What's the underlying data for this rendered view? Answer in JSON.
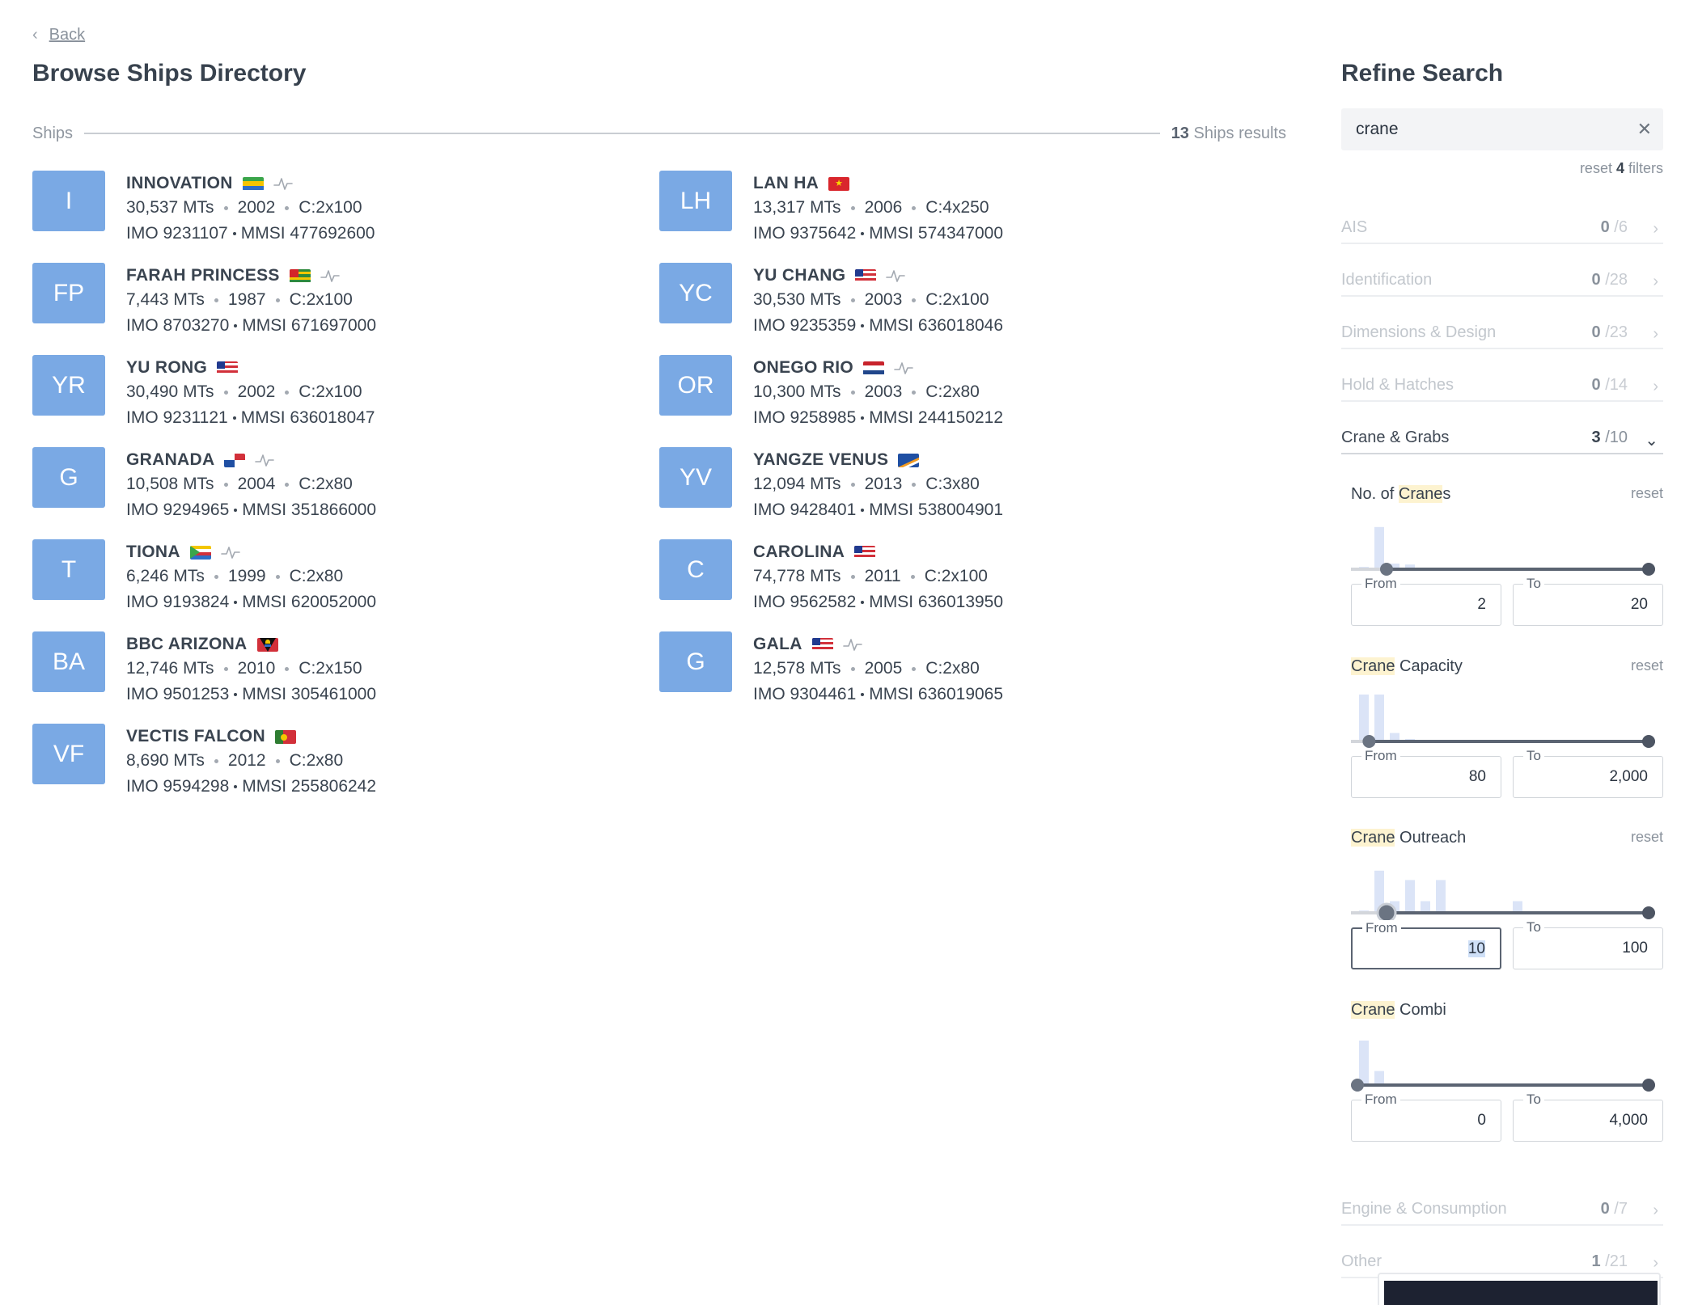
{
  "nav": {
    "back_label": "Back"
  },
  "page": {
    "title": "Browse Ships Directory"
  },
  "results": {
    "section_label": "Ships",
    "count": "13",
    "count_suffix": " Ships results"
  },
  "ships": [
    {
      "initials": "I",
      "name": "INNOVATION",
      "flag": "gabon",
      "ais": true,
      "dwt": "30,537 MTs",
      "year": "2002",
      "cranes": "C:2x100",
      "imo": "IMO 9231107",
      "mmsi": "MMSI 477692600"
    },
    {
      "initials": "FP",
      "name": "FARAH PRINCESS",
      "flag": "togo",
      "ais": true,
      "dwt": "7,443 MTs",
      "year": "1987",
      "cranes": "C:2x100",
      "imo": "IMO 8703270",
      "mmsi": "MMSI 671697000"
    },
    {
      "initials": "YR",
      "name": "YU RONG",
      "flag": "liberia",
      "ais": false,
      "dwt": "30,490 MTs",
      "year": "2002",
      "cranes": "C:2x100",
      "imo": "IMO 9231121",
      "mmsi": "MMSI 636018047"
    },
    {
      "initials": "G",
      "name": "GRANADA",
      "flag": "panama",
      "ais": true,
      "dwt": "10,508 MTs",
      "year": "2004",
      "cranes": "C:2x80",
      "imo": "IMO 9294965",
      "mmsi": "MMSI 351866000"
    },
    {
      "initials": "T",
      "name": "TIONA",
      "flag": "comoros",
      "ais": true,
      "dwt": "6,246 MTs",
      "year": "1999",
      "cranes": "C:2x80",
      "imo": "IMO 9193824",
      "mmsi": "MMSI 620052000"
    },
    {
      "initials": "BA",
      "name": "BBC ARIZONA",
      "flag": "antigua",
      "ais": false,
      "dwt": "12,746 MTs",
      "year": "2010",
      "cranes": "C:2x150",
      "imo": "IMO 9501253",
      "mmsi": "MMSI 305461000"
    },
    {
      "initials": "VF",
      "name": "VECTIS FALCON",
      "flag": "portugal",
      "ais": false,
      "dwt": "8,690 MTs",
      "year": "2012",
      "cranes": "C:2x80",
      "imo": "IMO 9594298",
      "mmsi": "MMSI 255806242"
    },
    {
      "initials": "LH",
      "name": "LAN HA",
      "flag": "vietnam",
      "ais": false,
      "dwt": "13,317 MTs",
      "year": "2006",
      "cranes": "C:4x250",
      "imo": "IMO 9375642",
      "mmsi": "MMSI 574347000"
    },
    {
      "initials": "YC",
      "name": "YU CHANG",
      "flag": "liberia",
      "ais": true,
      "dwt": "30,530 MTs",
      "year": "2003",
      "cranes": "C:2x100",
      "imo": "IMO 9235359",
      "mmsi": "MMSI 636018046"
    },
    {
      "initials": "OR",
      "name": "ONEGO RIO",
      "flag": "netherlands",
      "ais": true,
      "dwt": "10,300 MTs",
      "year": "2003",
      "cranes": "C:2x80",
      "imo": "IMO 9258985",
      "mmsi": "MMSI 244150212"
    },
    {
      "initials": "YV",
      "name": "YANGZE VENUS",
      "flag": "marshall",
      "ais": false,
      "dwt": "12,094 MTs",
      "year": "2013",
      "cranes": "C:3x80",
      "imo": "IMO 9428401",
      "mmsi": "MMSI 538004901"
    },
    {
      "initials": "C",
      "name": "CAROLINA",
      "flag": "liberia",
      "ais": false,
      "dwt": "74,778 MTs",
      "year": "2011",
      "cranes": "C:2x100",
      "imo": "IMO 9562582",
      "mmsi": "MMSI 636013950"
    },
    {
      "initials": "G",
      "name": "GALA",
      "flag": "liberia",
      "ais": true,
      "dwt": "12,578 MTs",
      "year": "2005",
      "cranes": "C:2x80",
      "imo": "IMO 9304461",
      "mmsi": "MMSI 636019065"
    }
  ],
  "refine": {
    "title": "Refine Search",
    "search_value": "crane",
    "reset_prefix": "reset ",
    "reset_count": "4",
    "reset_suffix": " filters",
    "facets": [
      {
        "label": "AIS",
        "selected": "0",
        "total": " /6",
        "open": false
      },
      {
        "label": "Identification",
        "selected": "0",
        "total": " /28",
        "open": false
      },
      {
        "label": "Dimensions & Design",
        "selected": "0",
        "total": " /23",
        "open": false
      },
      {
        "label": "Hold & Hatches",
        "selected": "0",
        "total": " /14",
        "open": false
      },
      {
        "label": "Crane & Grabs",
        "selected": "3",
        "total": " /10",
        "open": true
      },
      {
        "label": "Engine & Consumption",
        "selected": "0",
        "total": " /7",
        "open": false
      },
      {
        "label": "Other",
        "selected": "1",
        "total": " /21",
        "open": false
      }
    ],
    "filters": [
      {
        "title_pre": "No. of ",
        "title_hl": "Crane",
        "title_post": "s",
        "reset": "reset",
        "from_label": "From",
        "from": "2",
        "to_label": "To",
        "to": "20",
        "histogram": [
          0.05,
          0.9,
          0.12,
          0.1
        ],
        "start_fraction": 0.1,
        "end_fraction": 1.0
      },
      {
        "title_pre": "",
        "title_hl": "Crane",
        "title_post": " Capacity",
        "reset": "reset",
        "from_label": "From",
        "from": "80",
        "to_label": "To",
        "to": "2,000",
        "histogram": [
          1.0,
          1.0,
          0.18,
          0.05
        ],
        "start_fraction": 0.04,
        "end_fraction": 1.0
      },
      {
        "title_pre": "",
        "title_hl": "Crane",
        "title_post": " Outreach",
        "reset": "reset",
        "from_label": "From",
        "from": "10",
        "to_label": "To",
        "to": "100",
        "histogram": [
          0.05,
          0.9,
          0.25,
          0.7,
          0.25,
          0.7,
          0.0,
          0.0,
          0.0,
          0.0,
          0.25
        ],
        "start_fraction": 0.1,
        "end_fraction": 1.0
      },
      {
        "title_pre": "",
        "title_hl": "Crane",
        "title_post": " Combi",
        "reset": "",
        "from_label": "From",
        "from": "0",
        "to_label": "To",
        "to": "4,000",
        "histogram": [
          0.95,
          0.3,
          0.03
        ],
        "start_fraction": 0.0,
        "end_fraction": 1.0
      }
    ]
  },
  "colors": {
    "avatar": "#7aa9e4",
    "slider_track": "#5b6472",
    "histogram": "#dbe4f7",
    "highlight": "#fdf3d0"
  }
}
